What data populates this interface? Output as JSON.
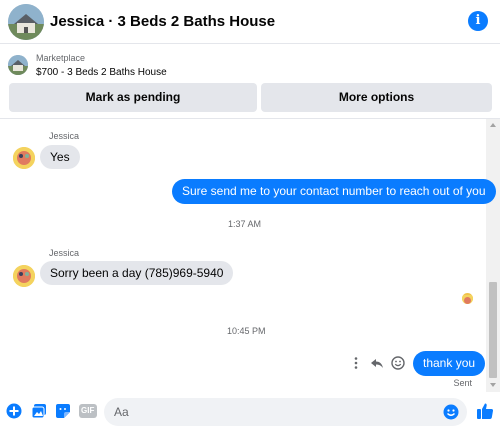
{
  "header": {
    "title": "Jessica · 3 Beds 2 Baths House",
    "info_icon": "info-icon"
  },
  "marketplace": {
    "label": "Marketplace",
    "listing": "$700 - 3 Beds 2 Baths House",
    "buttons": {
      "pending": "Mark as pending",
      "more": "More options"
    }
  },
  "messages": [
    {
      "sender": "Jessica",
      "text": "Yes",
      "direction": "in"
    },
    {
      "text": "Sure send me to your contact number to reach out of you",
      "direction": "out"
    },
    {
      "timestamp": "1:37 AM"
    },
    {
      "sender": "Jessica",
      "text": "Sorry been a day (785)969-5940",
      "direction": "in"
    },
    {
      "timestamp": "10:45 PM"
    },
    {
      "text": "thank you",
      "direction": "out",
      "status": "Sent"
    }
  ],
  "composer": {
    "placeholder": "Aa",
    "gif_label": "GIF"
  },
  "colors": {
    "accent": "#0a7cff",
    "incoming_bubble": "#e4e6eb",
    "secondary_text": "#65676b"
  }
}
